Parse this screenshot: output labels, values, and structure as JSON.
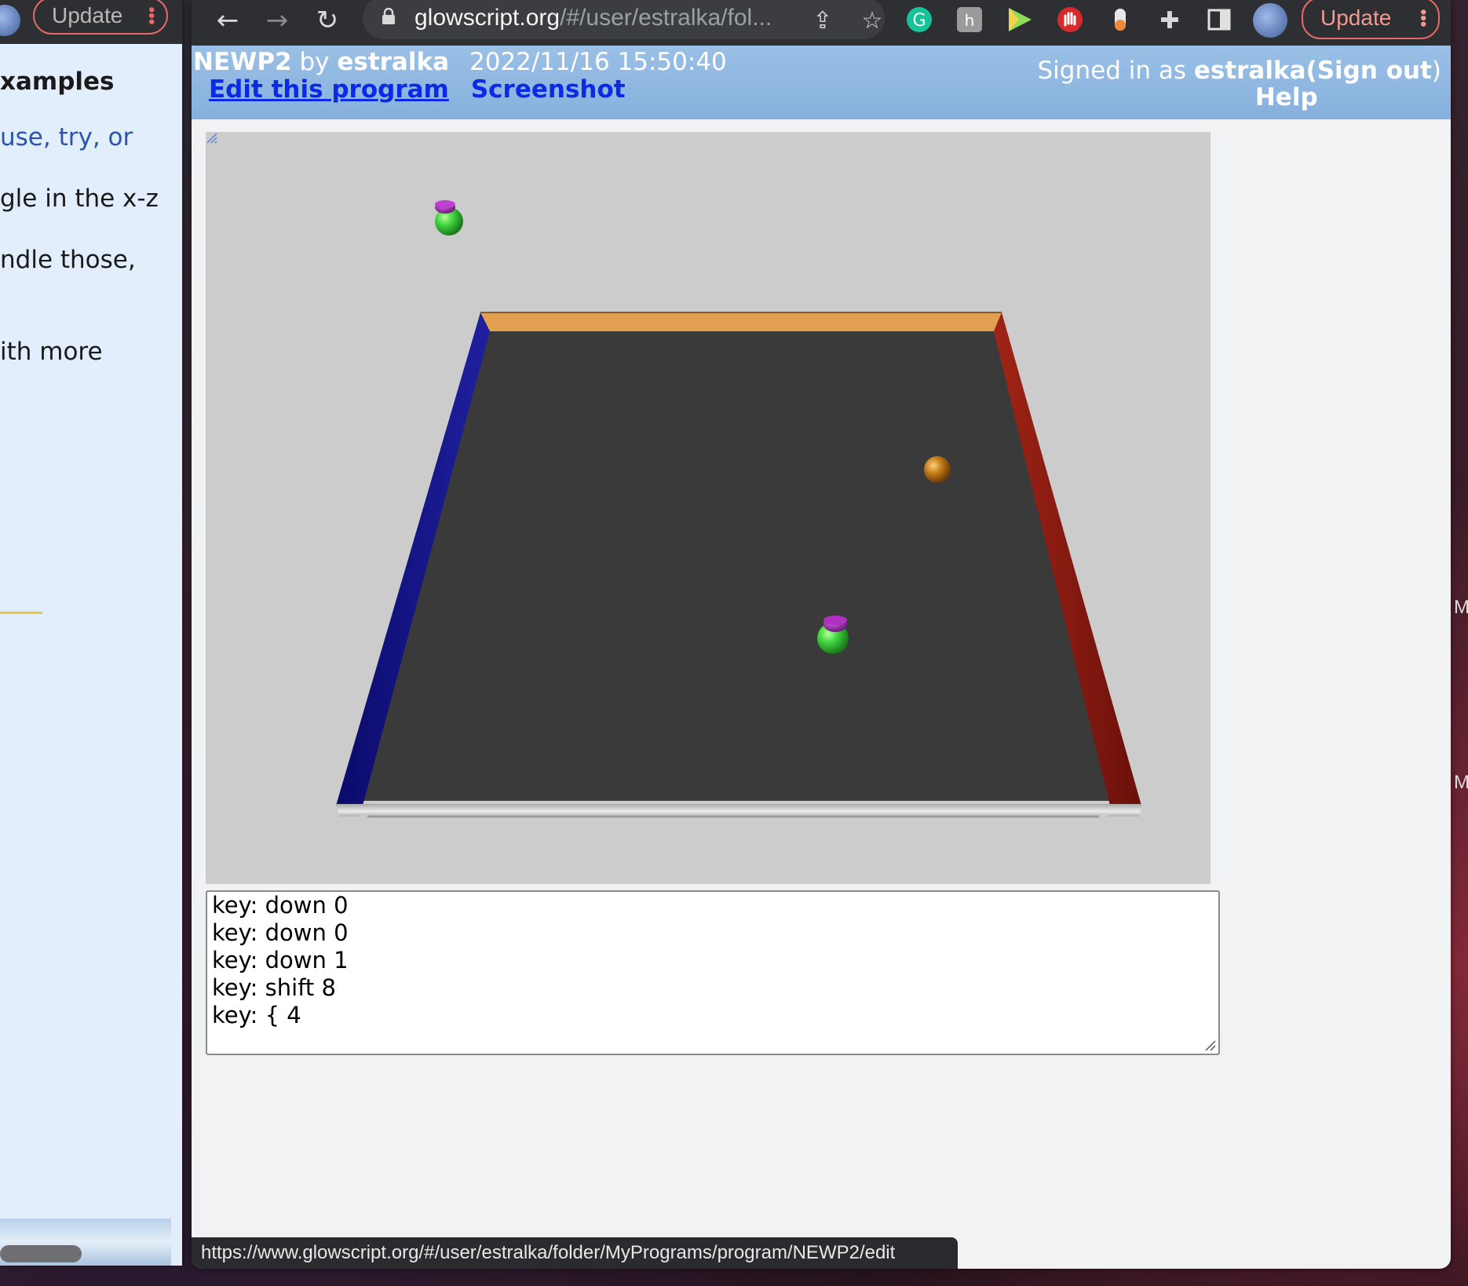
{
  "left_window": {
    "update_label": "Update",
    "lines": [
      {
        "text": "xamples",
        "style": "bold"
      },
      {
        "text": "use, try, or",
        "style": "link"
      },
      {
        "text": "gle in the x-z",
        "style": "normal"
      },
      {
        "text": "ndle those,",
        "style": "normal"
      },
      {
        "text": "ith more",
        "style": "normal"
      }
    ]
  },
  "browser": {
    "url_host": "glowscript.org",
    "url_path": "/#/user/estralka/fol...",
    "update_label": "Update",
    "accent": "#e66a63"
  },
  "gs_header": {
    "program_name": "NEWP2",
    "by_label": " by ",
    "author": "estralka",
    "datetime": "2022/11/16 15:50:40",
    "edit_link": "Edit this program",
    "screenshot_link": "Screenshot",
    "signed_in_prefix": "Signed in as ",
    "signed_in_user": "estralka",
    "sign_out_open": "(",
    "sign_out": "Sign out",
    "sign_out_close": ")",
    "help": "Help"
  },
  "scene": {
    "background": "#cccccc",
    "floor_color": "#3a3a3a",
    "wall_left_color": "#1a1a8a",
    "wall_right_color": "#8a1a12",
    "wall_back_color": "#e0a050",
    "wall_front_color": "#d8d8d8",
    "player_body_color": "#3fd63f",
    "player_hat_color": "#8a1a9a",
    "ball_color": "#c07818"
  },
  "log": {
    "lines": [
      "key: down 0",
      "key: down 0",
      "key: down 1",
      "key: shift 8",
      "key: { 4"
    ]
  },
  "status_url": "https://www.glowscript.org/#/user/estralka/folder/MyPrograms/program/NEWP2/edit",
  "right_edge_letters": [
    "M",
    "M"
  ]
}
